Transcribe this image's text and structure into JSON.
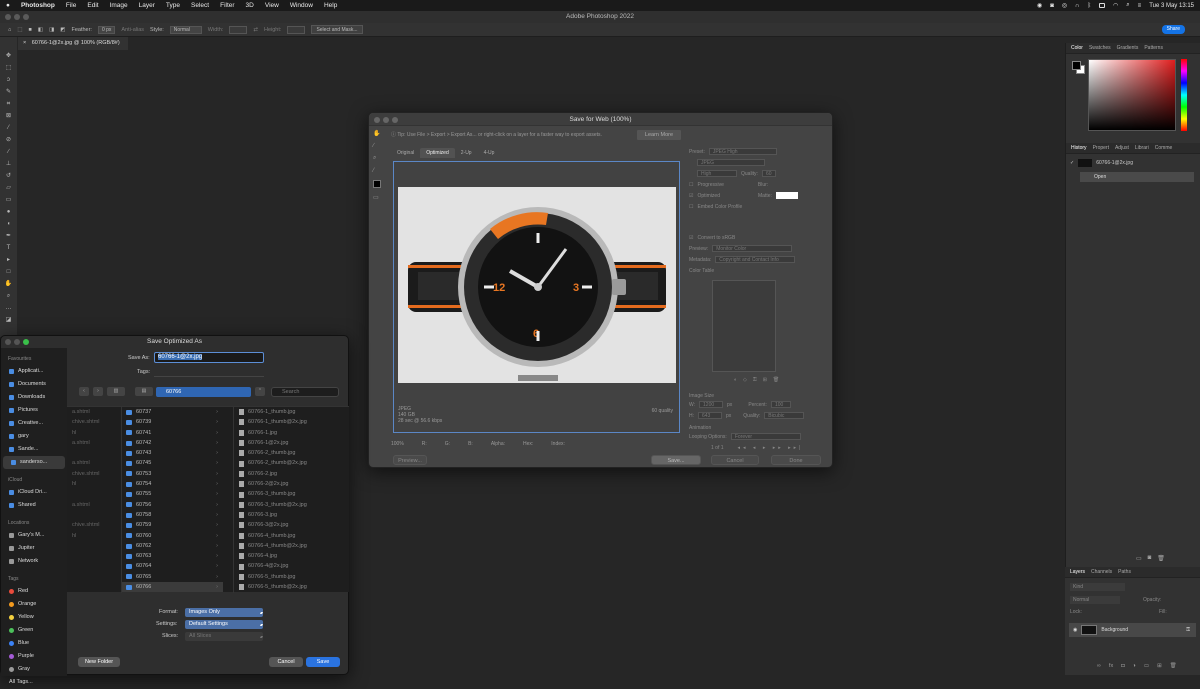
{
  "menubar": {
    "apple": "",
    "items": [
      "Photoshop",
      "File",
      "Edit",
      "Image",
      "Layer",
      "Type",
      "Select",
      "Filter",
      "3D",
      "View",
      "Window",
      "Help"
    ],
    "clock": "Tue 3 May  13:15"
  },
  "app_title": "Adobe Photoshop 2022",
  "options": {
    "feather_label": "Feather:",
    "feather_value": "0 px",
    "antialias": "Anti-alias",
    "style_label": "Style:",
    "style_value": "Normal",
    "width_label": "Width:",
    "height_label": "Height:",
    "select_mask": "Select and Mask...",
    "share": "Share"
  },
  "doc_tab": "60766-1@2x.jpg @ 100% (RGB/8#)",
  "right_panel": {
    "color_tabs": [
      "Color",
      "Swatches",
      "Gradients",
      "Patterns"
    ],
    "history_tabs": [
      "History",
      "Propert",
      "Adjust",
      "Librari",
      "Comme"
    ],
    "history_items": [
      "60766-1@2x.jpg",
      "Open"
    ],
    "layers_tabs": [
      "Layers",
      "Channels",
      "Paths"
    ],
    "kind": "Kind",
    "blend": "Normal",
    "opacity": "Opacity:",
    "lock": "Lock:",
    "fill": "Fill:",
    "layer_name": "Background"
  },
  "sfw": {
    "title": "Save for Web (100%)",
    "tip": "Tip: Use File > Export > Export As... or right-click on a layer for a faster way to export assets.",
    "learn_more": "Learn More",
    "tabs": [
      "Original",
      "Optimized",
      "2-Up",
      "4-Up"
    ],
    "info_format": "JPEG",
    "info_size": "140 GB",
    "info_time": "28 sec @ 56.6 kbps",
    "info_quality": "60 quality",
    "zoom": "100%",
    "r": "R:",
    "g": "G:",
    "b": "B:",
    "alpha": "Alpha:",
    "hex": "Hex:",
    "index": "Index:",
    "preview_btn": "Preview...",
    "save_btn": "Save...",
    "cancel_btn": "Cancel",
    "done_btn": "Done",
    "preset_label": "Preset:",
    "preset_value": "JPEG High",
    "format_value": "JPEG",
    "compression": "High",
    "quality_label": "Quality:",
    "quality_value": "60",
    "progressive": "Progressive",
    "blur_label": "Blur:",
    "optimized": "Optimized",
    "matte_label": "Matte:",
    "embed_profile": "Embed Color Profile",
    "convert_srgb": "Convert to sRGB",
    "preview_label": "Preview:",
    "preview_value": "Monitor Color",
    "metadata_label": "Metadata:",
    "metadata_value": "Copyright and Contact Info",
    "color_table": "Color Table",
    "image_size": "Image Size",
    "w_label": "W:",
    "w_value": "1200",
    "h_label": "H:",
    "h_value": "643",
    "px": "px",
    "percent_label": "Percent:",
    "percent_value": "100",
    "quality2_label": "Quality:",
    "quality2_value": "Bicubic",
    "animation": "Animation",
    "looping_label": "Looping Options:",
    "looping_value": "Forever",
    "frame_count": "1 of 1"
  },
  "saveas": {
    "title": "Save Optimized As",
    "save_as_label": "Save As:",
    "filename": "60766-1@2x.jpg",
    "tags_label": "Tags:",
    "folder": "60766",
    "search_placeholder": "Search",
    "favourites_header": "Favourites",
    "favourites": [
      "Applicati...",
      "Documents",
      "Downloads",
      "Pictures",
      "Creative...",
      "gary",
      "Sande...",
      "sanderso..."
    ],
    "icloud_header": "iCloud",
    "icloud": [
      "iCloud Dri...",
      "Shared"
    ],
    "locations_header": "Locations",
    "locations": [
      "Gary's M...",
      "Jupiter",
      "Network"
    ],
    "tags_header": "Tags",
    "tags": [
      {
        "name": "Red",
        "color": "#e94b3c"
      },
      {
        "name": "Orange",
        "color": "#f39a1e"
      },
      {
        "name": "Yellow",
        "color": "#f4d03f"
      },
      {
        "name": "Green",
        "color": "#4cc15b"
      },
      {
        "name": "Blue",
        "color": "#3b82f6"
      },
      {
        "name": "Purple",
        "color": "#a45bd6"
      },
      {
        "name": "Gray",
        "color": "#9a9a9a"
      },
      {
        "name": "All Tags...",
        "color": ""
      }
    ],
    "col1": [
      "a.shtml",
      "chive.shtml",
      "hl",
      "a.shtml",
      "",
      "a.shtml",
      "chive.shtml",
      "hl",
      "",
      "a.shtml",
      "",
      "chive.shtml",
      "hl",
      "",
      ""
    ],
    "col2": [
      "60737",
      "60739",
      "60741",
      "60742",
      "60743",
      "60745",
      "60753",
      "60754",
      "60755",
      "60756",
      "60758",
      "60759",
      "60760",
      "60762",
      "60763",
      "60764",
      "60765",
      "60766"
    ],
    "col3": [
      "60766-1_thumb.jpg",
      "60766-1_thumb@2x.jpg",
      "60766-1.jpg",
      "60766-1@2x.jpg",
      "60766-2_thumb.jpg",
      "60766-2_thumb@2x.jpg",
      "60766-2.jpg",
      "60766-2@2x.jpg",
      "60766-3_thumb.jpg",
      "60766-3_thumb@2x.jpg",
      "60766-3.jpg",
      "60766-3@2x.jpg",
      "60766-4_thumb.jpg",
      "60766-4_thumb@2x.jpg",
      "60766-4.jpg",
      "60766-4@2x.jpg",
      "60766-5_thumb.jpg",
      "60766-5_thumb@2x.jpg"
    ],
    "format_label": "Format:",
    "format_value": "Images Only",
    "settings_label": "Settings:",
    "settings_value": "Default Settings",
    "slices_label": "Slices:",
    "slices_value": "All Slices",
    "new_folder": "New Folder",
    "cancel": "Cancel",
    "save": "Save"
  }
}
